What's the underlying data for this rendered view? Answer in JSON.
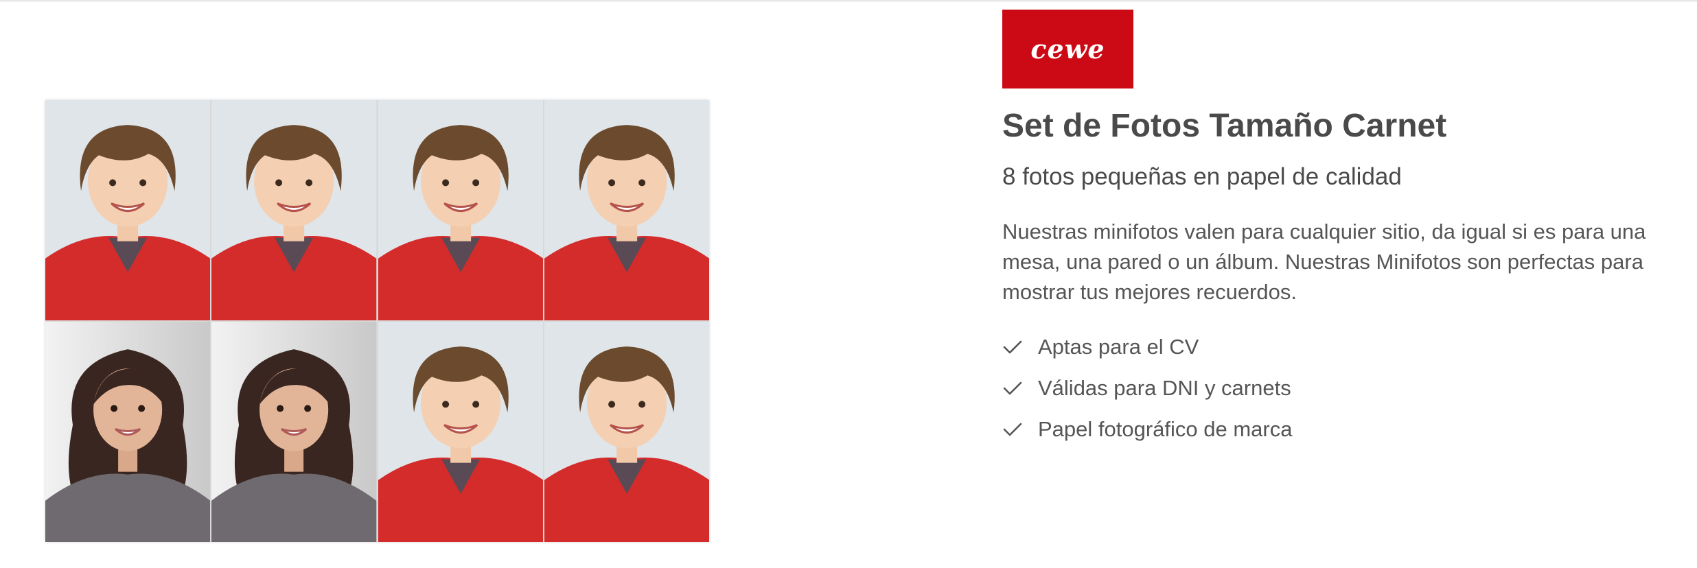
{
  "brand": {
    "logo_text": "cewe",
    "color": "#cc0a15"
  },
  "product": {
    "title": "Set de Fotos Tamaño Carnet",
    "subtitle": "8 fotos pequeñas en papel de calidad",
    "description": "Nuestras minifotos valen para cualquier sitio, da igual si es para una mesa, una pared o un álbum. Nuestras Minifotos son perfectas para mostrar tus mejores recuerdos.",
    "features": [
      {
        "label": "Aptas para el CV",
        "icon": "check-icon"
      },
      {
        "label": "Válidas para DNI y carnets",
        "icon": "check-icon"
      },
      {
        "label": "Papel fotográfico de marca",
        "icon": "check-icon"
      }
    ]
  },
  "photo_sheet": {
    "photos": [
      {
        "subject": "boy",
        "background": "light-blue"
      },
      {
        "subject": "boy",
        "background": "light-blue"
      },
      {
        "subject": "boy",
        "background": "light-blue"
      },
      {
        "subject": "boy",
        "background": "light-blue"
      },
      {
        "subject": "girl",
        "background": "light-grey"
      },
      {
        "subject": "girl",
        "background": "light-grey"
      },
      {
        "subject": "boy",
        "background": "light-blue"
      },
      {
        "subject": "boy",
        "background": "light-blue"
      }
    ]
  }
}
